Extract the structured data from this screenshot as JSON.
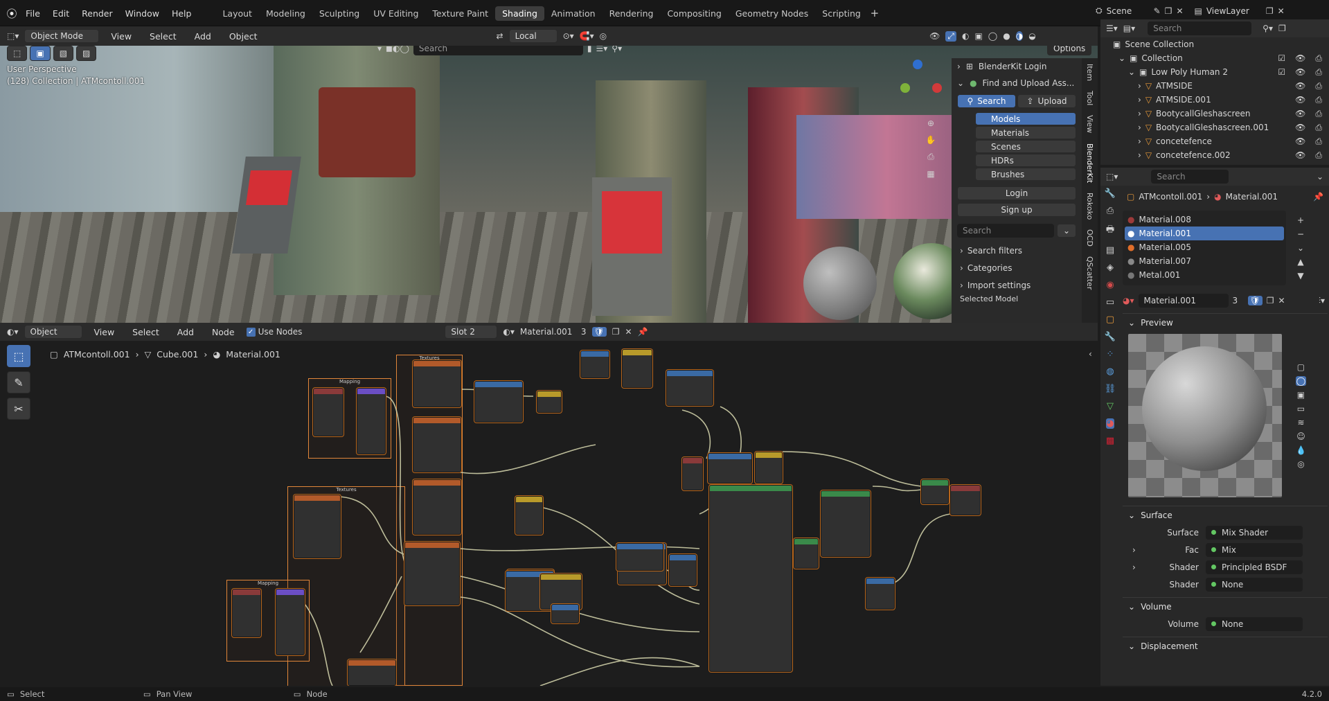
{
  "menu": {
    "items": [
      "File",
      "Edit",
      "Render",
      "Window",
      "Help"
    ]
  },
  "workspaces": {
    "tabs": [
      "Layout",
      "Modeling",
      "Sculpting",
      "UV Editing",
      "Texture Paint",
      "Shading",
      "Animation",
      "Rendering",
      "Compositing",
      "Geometry Nodes",
      "Scripting"
    ],
    "active": "Shading"
  },
  "scene": {
    "label": "Scene",
    "viewlayer": "ViewLayer"
  },
  "viewport": {
    "mode": "Object Mode",
    "menus": [
      "View",
      "Select",
      "Add",
      "Object"
    ],
    "transform": "Local",
    "search_placeholder": "Search",
    "options": "Options",
    "perspective": "User Perspective",
    "collection_info": "(128) Collection | ATMcontoll.001"
  },
  "blenderkit": {
    "login_header": "BlenderKit Login",
    "find_header": "Find and Upload Ass...",
    "search_tab": "Search",
    "upload_tab": "Upload",
    "asset_types": [
      "Models",
      "Materials",
      "Scenes",
      "HDRs",
      "Brushes"
    ],
    "login": "Login",
    "signup": "Sign up",
    "search_placeholder": "Search",
    "search_filters": "Search filters",
    "categories": "Categories",
    "import_settings": "Import settings",
    "selected_model": "Selected Model"
  },
  "side_tabs": [
    "Item",
    "Tool",
    "View",
    "BlenderKit",
    "Rokoko",
    "OCD",
    "QScatter"
  ],
  "outliner": {
    "search_placeholder": "Search",
    "scene_collection": "Scene Collection",
    "collection": "Collection",
    "group": "Low Poly Human 2",
    "items": [
      "ATMSIDE",
      "ATMSIDE.001",
      "BootycallGleshascreen",
      "BootycallGleshascreen.001",
      "concetefence",
      "concetefence.002"
    ]
  },
  "node_editor": {
    "type": "Object",
    "menus": [
      "View",
      "Select",
      "Add",
      "Node"
    ],
    "use_nodes": "Use Nodes",
    "slot": "Slot 2",
    "material": "Material.001",
    "users": "3",
    "breadcrumb": [
      "ATMcontoll.001",
      "Cube.001",
      "Material.001"
    ],
    "frame_labels": [
      "Mapping",
      "Textures",
      "Textures",
      "Mapping"
    ]
  },
  "properties": {
    "search_placeholder": "Search",
    "breadcrumb": [
      "ATMcontoll.001",
      "Material.001"
    ],
    "slots": [
      "Material.008",
      "Material.001",
      "Material.005",
      "Material.007",
      "Metal.001"
    ],
    "selected_slot": "Material.001",
    "material_name": "Material.001",
    "users": "3",
    "preview": "Preview",
    "surface_section": "Surface",
    "surface_label": "Surface",
    "surface_value": "Mix Shader",
    "fac_label": "Fac",
    "fac_value": "Mix",
    "shader1_label": "Shader",
    "shader1_value": "Principled BSDF",
    "shader2_label": "Shader",
    "shader2_value": "None",
    "volume_section": "Volume",
    "volume_label": "Volume",
    "volume_value": "None",
    "displacement_section": "Displacement"
  },
  "statusbar": {
    "select": "Select",
    "pan": "Pan View",
    "node": "Node",
    "version": "4.2.0"
  },
  "colors": {
    "accent": "#4772b3",
    "frame": "#e2873a",
    "header": "#303030"
  }
}
